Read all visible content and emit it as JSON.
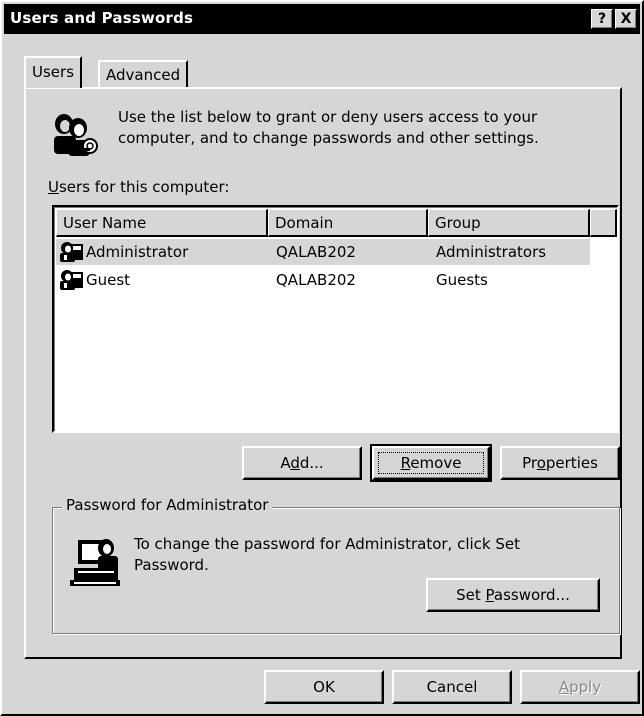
{
  "window": {
    "title": "Users and Passwords",
    "help_button": "?",
    "close_button": "X"
  },
  "tabs": [
    {
      "label": "Users",
      "active": true
    },
    {
      "label": "Advanced",
      "active": false
    }
  ],
  "intro": {
    "icon": "users-keys-icon",
    "text": "Use the list below to grant or deny users access to your computer, and to change passwords and other settings."
  },
  "users_list": {
    "label_mnemonic": "U",
    "label_rest": "sers for this computer:",
    "columns": [
      "User Name",
      "Domain",
      "Group"
    ],
    "rows": [
      {
        "user": "Administrator",
        "domain": "QALAB202",
        "group": "Administrators",
        "selected": true,
        "icon": "user-icon"
      },
      {
        "user": "Guest",
        "domain": "QALAB202",
        "group": "Guests",
        "selected": false,
        "icon": "user-icon"
      }
    ]
  },
  "list_buttons": {
    "add_pre": "A",
    "add_mn": "d",
    "add_post": "d...",
    "remove_mn": "R",
    "remove_post": "emove",
    "properties_pre": "Pr",
    "properties_mn": "o",
    "properties_post": "perties"
  },
  "password_group": {
    "legend": "Password for Administrator",
    "icon": "computer-user-icon",
    "text": "To change the password for Administrator, click Set Password.",
    "set_pre": "Set ",
    "set_mn": "P",
    "set_post": "assword..."
  },
  "footer_buttons": {
    "ok": "OK",
    "cancel": "Cancel",
    "apply_mn": "A",
    "apply_post": "pply"
  },
  "colors": {
    "face": "#d6d6d6",
    "titlebar": "#000000",
    "selection": "#d6d6d6"
  }
}
